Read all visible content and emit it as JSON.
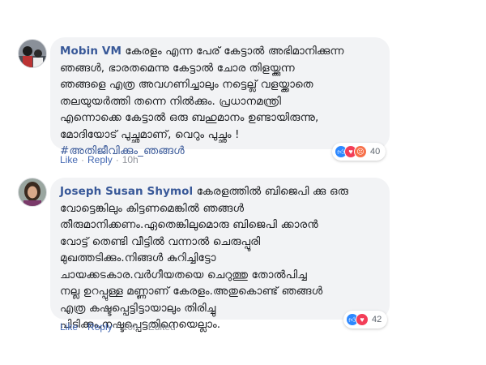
{
  "comments": [
    {
      "author": "Mobin VM",
      "lines": [
        "കേരളം എന്ന പേര് കേട്ടാൽ അഭിമാനിക്കുന്ന",
        "ഞങ്ങൾ, ഭാരതമെന്നു കേട്ടാൽ ചോര തിളയ്ക്കുന്ന",
        "ഞങ്ങളെ എത്ര അവഗണിച്ചാലും നട്ടെല്ല് വളയ്ക്കാതെ",
        "തലയുയർത്തി തന്നെ നിൽക്കും. പ്രധാനമന്ത്രി",
        "എന്നൊക്കെ കേട്ടാൽ ഒരു ബഹുമാനം ഉണ്ടായിരുന്നു,",
        "മോദിയോട് പുച്ഛമാണ്, വെറും പുച്ഛം !"
      ],
      "hashtag": "#അതിജീവിക്കും_ഞങ്ങൾ",
      "actions": {
        "like": "Like",
        "reply": "Reply",
        "time": "10h",
        "edited": ""
      },
      "reactions": {
        "count": "40",
        "types": [
          "like",
          "love",
          "angry"
        ]
      }
    },
    {
      "author": "Joseph Susan Shymol",
      "lines": [
        "കേരളത്തിൽ ബിജെപി ക്കു ഒരു",
        "വോട്ടെങ്കിലും കിട്ടണമെങ്കിൽ ഞങ്ങൾ",
        "തീരുമാനിക്കണം.ഏതെങ്കിലുമൊരു ബിജെപി ക്കാരൻ",
        "വോട്ട് തെണ്ടി വീട്ടിൽ വന്നാൽ ചെരുപ്പൂരി",
        "മുഖത്തടിക്കും.നിങ്ങൾ കുറിച്ചിട്ടോ",
        "ചായക്കടകാര.വർഗീയതയെ ചെറുത്തു തോൽപിച്ച",
        "നല്ല ഉറപ്പുള്ള മണ്ണാണ് കേരളം.അതുകൊണ്ട് ഞങ്ങൾ",
        "എത്ര കഷ്ടപ്പെട്ടിട്ടായാലും തിരിച്ചു",
        "പിടിക്കും,നഷ്ടപ്പെട്ടതിനെയെല്ലാം."
      ],
      "hashtag": "",
      "actions": {
        "like": "Like",
        "reply": "Reply",
        "time": "10h",
        "edited": "Edited"
      },
      "reactions": {
        "count": "42",
        "types": [
          "like",
          "love"
        ]
      }
    }
  ],
  "colors": {
    "link": "#385898",
    "bubble": "#f2f3f5",
    "meta": "#90949c"
  }
}
